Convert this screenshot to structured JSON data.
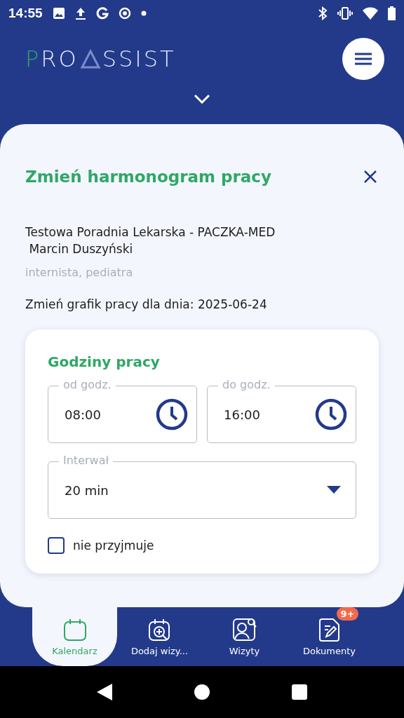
{
  "status_bar": {
    "time": "14:55"
  },
  "logo": {
    "first": "P",
    "middle": "RO",
    "last": "SSIST"
  },
  "dialog": {
    "title": "Zmień harmonogram pracy",
    "clinic": "Testowa Poradnia Lekarska - PACZKA-MED",
    "doctor": "Marcin Duszyński",
    "specialty": "internista, pediatra",
    "date_line": "Zmień grafik pracy dla dnia: 2025-06-24",
    "hours": {
      "title": "Godziny pracy",
      "from": {
        "label": "od godz.",
        "value": "08:00"
      },
      "to": {
        "label": "do godz.",
        "value": "16:00"
      },
      "interval": {
        "label": "Interwał",
        "value": "20 min"
      },
      "not_accepting": {
        "label": "nie przyjmuje",
        "checked": false
      }
    }
  },
  "nav": [
    {
      "label": "Kalendarz",
      "kind": "calendar",
      "selected": true
    },
    {
      "label": "Dodaj wizy...",
      "kind": "calendar-search",
      "selected": false
    },
    {
      "label": "Wizyty",
      "kind": "person-search",
      "selected": false
    },
    {
      "label": "Dokumenty",
      "kind": "document",
      "selected": false,
      "badge": "9+"
    }
  ]
}
